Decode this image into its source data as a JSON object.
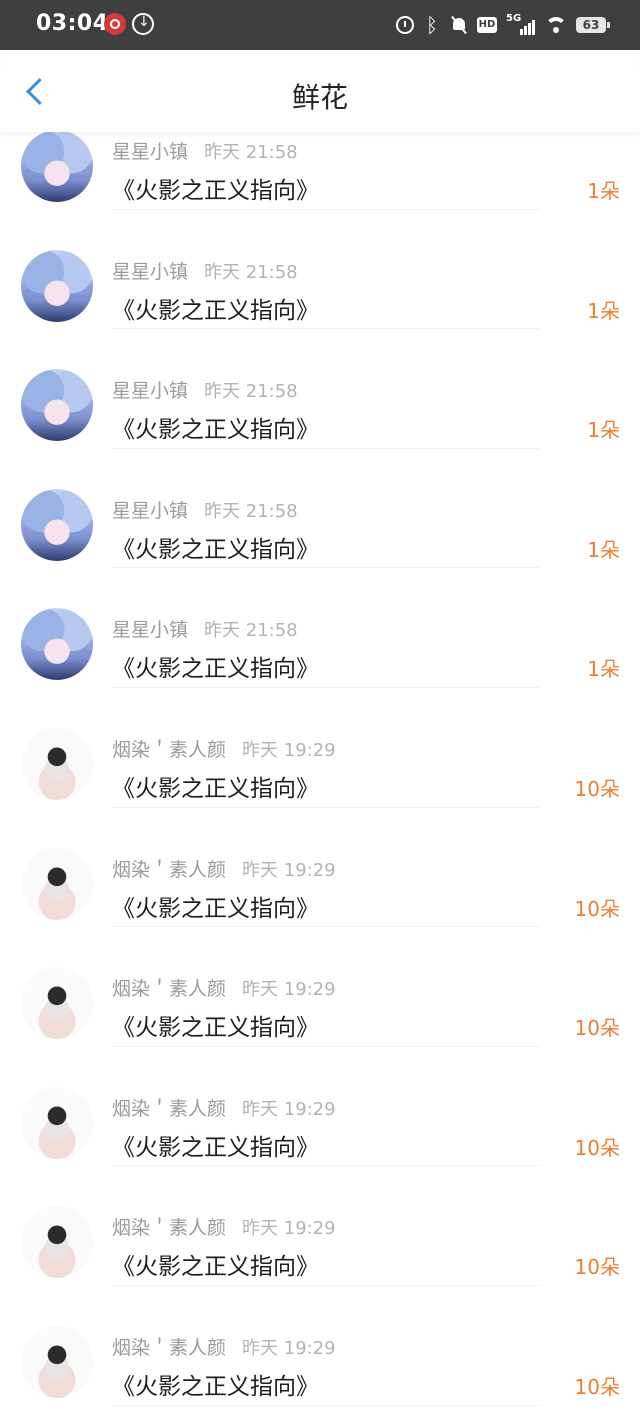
{
  "status_bar": {
    "time": "03:04",
    "battery": "63",
    "network": "5G",
    "hd": "HD"
  },
  "header": {
    "title": "鲜花"
  },
  "items": [
    {
      "name": "星星小镇",
      "time": "昨天 21:58",
      "book": "《火影之正义指向》",
      "count": "1朵",
      "avatar": "anime-blue-hair-avatar"
    },
    {
      "name": "星星小镇",
      "time": "昨天 21:58",
      "book": "《火影之正义指向》",
      "count": "1朵",
      "avatar": "anime-blue-hair-avatar"
    },
    {
      "name": "星星小镇",
      "time": "昨天 21:58",
      "book": "《火影之正义指向》",
      "count": "1朵",
      "avatar": "anime-blue-hair-avatar"
    },
    {
      "name": "星星小镇",
      "time": "昨天 21:58",
      "book": "《火影之正义指向》",
      "count": "1朵",
      "avatar": "anime-blue-hair-avatar"
    },
    {
      "name": "星星小镇",
      "time": "昨天 21:58",
      "book": "《火影之正义指向》",
      "count": "1朵",
      "avatar": "anime-blue-hair-avatar"
    },
    {
      "name": "烟染＇素人颜",
      "time": "昨天 19:29",
      "book": "《火影之正义指向》",
      "count": "10朵",
      "avatar": "hands-sketch-avatar"
    },
    {
      "name": "烟染＇素人颜",
      "time": "昨天 19:29",
      "book": "《火影之正义指向》",
      "count": "10朵",
      "avatar": "hands-sketch-avatar"
    },
    {
      "name": "烟染＇素人颜",
      "time": "昨天 19:29",
      "book": "《火影之正义指向》",
      "count": "10朵",
      "avatar": "hands-sketch-avatar"
    },
    {
      "name": "烟染＇素人颜",
      "time": "昨天 19:29",
      "book": "《火影之正义指向》",
      "count": "10朵",
      "avatar": "hands-sketch-avatar"
    },
    {
      "name": "烟染＇素人颜",
      "time": "昨天 19:29",
      "book": "《火影之正义指向》",
      "count": "10朵",
      "avatar": "hands-sketch-avatar"
    },
    {
      "name": "烟染＇素人颜",
      "time": "昨天 19:29",
      "book": "《火影之正义指向》",
      "count": "10朵",
      "avatar": "hands-sketch-avatar"
    }
  ]
}
